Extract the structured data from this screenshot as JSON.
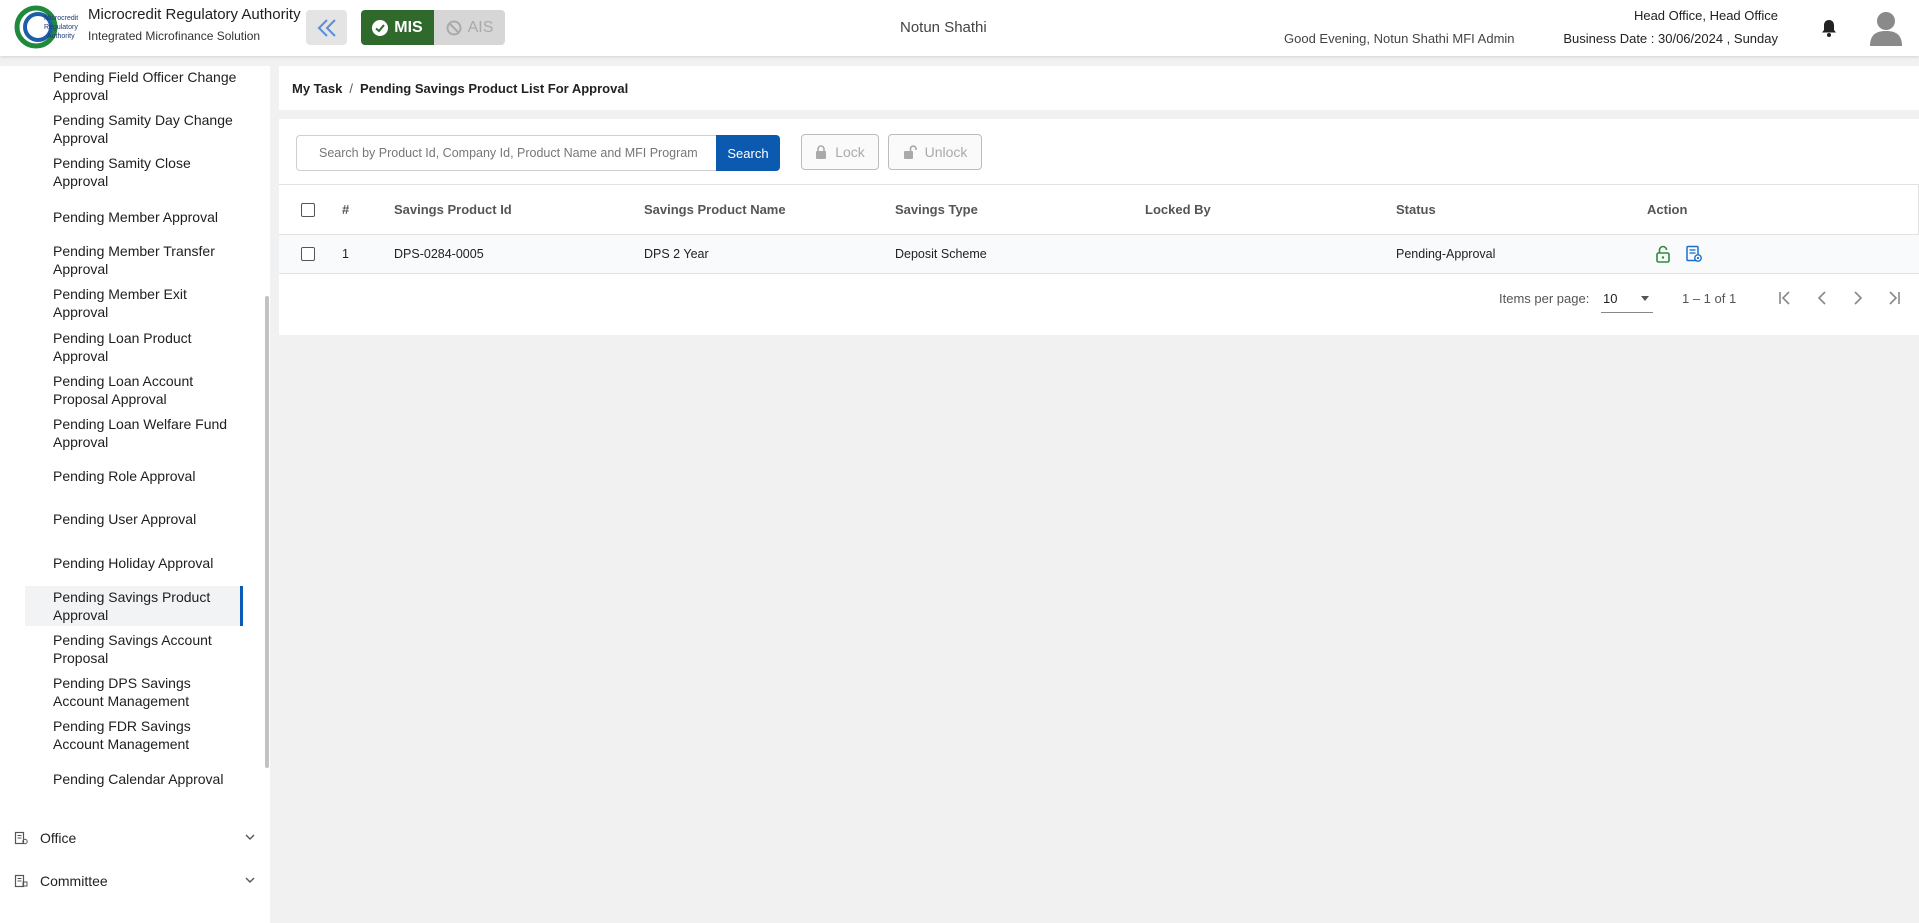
{
  "header": {
    "brand_title": "Microcredit Regulatory Authority",
    "brand_subtitle": "Integrated Microfinance Solution",
    "logo_text": "Microcredit Regulatory Authority",
    "mis_label": "MIS",
    "ais_label": "AIS",
    "org_name": "Notun Shathi",
    "greeting": "Good Evening, Notun Shathi MFI Admin",
    "office": "Head Office, Head Office",
    "business_date": "Business Date : 30/06/2024 , Sunday"
  },
  "sidebar": {
    "items": [
      {
        "label": "Pending Field Officer Change Approval"
      },
      {
        "label": "Pending Samity Day Change Approval"
      },
      {
        "label": "Pending Samity Close Approval"
      },
      {
        "label": "Pending Member Approval"
      },
      {
        "label": "Pending Member Transfer Approval"
      },
      {
        "label": "Pending Member Exit Approval"
      },
      {
        "label": "Pending Loan Product Approval"
      },
      {
        "label": "Pending Loan Account Proposal Approval"
      },
      {
        "label": "Pending Loan Welfare Fund Approval"
      },
      {
        "label": "Pending Role Approval"
      },
      {
        "label": "Pending User Approval"
      },
      {
        "label": "Pending Holiday Approval"
      },
      {
        "label": "Pending Savings Product Approval"
      },
      {
        "label": "Pending Savings Account Proposal"
      },
      {
        "label": "Pending DPS Savings Account Management"
      },
      {
        "label": "Pending FDR Savings Account Management"
      },
      {
        "label": "Pending Calendar Approval"
      }
    ],
    "active_index": 12,
    "groups": [
      {
        "label": "Office"
      },
      {
        "label": "Committee"
      }
    ]
  },
  "breadcrumb": {
    "root": "My Task",
    "separator": "/",
    "current": "Pending Savings Product List For Approval"
  },
  "toolbar": {
    "search_placeholder": "Search by Product Id, Company Id, Product Name and MFI Program",
    "search_label": "Search",
    "lock_label": "Lock",
    "unlock_label": "Unlock"
  },
  "table": {
    "columns": [
      "#",
      "Savings Product Id",
      "Savings Product Name",
      "Savings Type",
      "Locked By",
      "Status",
      "Action"
    ],
    "rows": [
      {
        "index": "1",
        "product_id": "DPS-0284-0005",
        "product_name": "DPS 2 Year",
        "savings_type": "Deposit Scheme",
        "locked_by": "",
        "status": "Pending-Approval"
      }
    ]
  },
  "paginator": {
    "items_per_page_label": "Items per page:",
    "page_size": "10",
    "range": "1 – 1 of 1"
  },
  "colors": {
    "primary": "#0c5ab0",
    "mis_green": "#2f6a2c",
    "active_border": "#0b5ab8",
    "unlock_icon": "#2e8b3a",
    "view_icon": "#1b6fc9"
  }
}
